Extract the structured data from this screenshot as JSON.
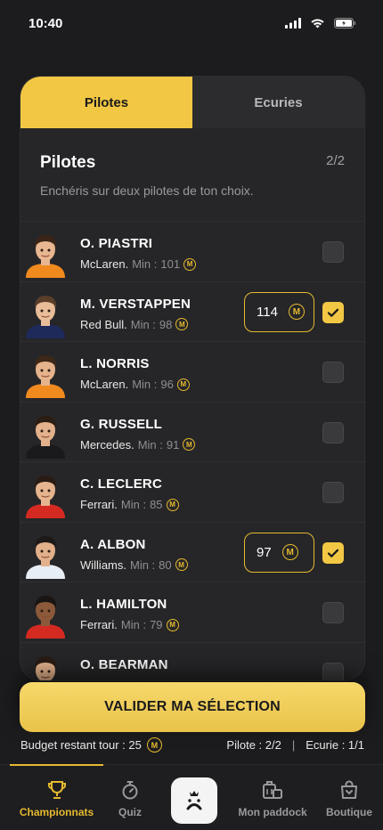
{
  "status": {
    "time": "10:40"
  },
  "tabs": [
    {
      "label": "Pilotes",
      "active": true
    },
    {
      "label": "Ecuries",
      "active": false
    }
  ],
  "section": {
    "title": "Pilotes",
    "count": "2/2",
    "subtitle": "Enchéris sur deux pilotes de ton choix."
  },
  "min_label": "Min :",
  "coin_symbol": "M",
  "drivers": [
    {
      "name": "O. PIASTRI",
      "team": "McLaren.",
      "min": "101",
      "checked": false,
      "bid": "",
      "suit": "#f08a1f",
      "hair": "#3a2417",
      "skin": "#e8b690"
    },
    {
      "name": "M. VERSTAPPEN",
      "team": "Red Bull.",
      "min": "98",
      "checked": true,
      "bid": "114",
      "suit": "#1d2a5a",
      "hair": "#5a3e2a",
      "skin": "#e9bd9a"
    },
    {
      "name": "L. NORRIS",
      "team": "McLaren.",
      "min": "96",
      "checked": false,
      "bid": "",
      "suit": "#f08a1f",
      "hair": "#3d2718",
      "skin": "#e6b38c"
    },
    {
      "name": "G. RUSSELL",
      "team": "Mercedes.",
      "min": "91",
      "checked": false,
      "bid": "",
      "suit": "#1a1a1c",
      "hair": "#2b1d14",
      "skin": "#e3b18c"
    },
    {
      "name": "C. LECLERC",
      "team": "Ferrari.",
      "min": "85",
      "checked": false,
      "bid": "",
      "suit": "#d42a22",
      "hair": "#2a1c14",
      "skin": "#e6b48e"
    },
    {
      "name": "A. ALBON",
      "team": "Williams.",
      "min": "80",
      "checked": true,
      "bid": "97",
      "suit": "#e8eef6",
      "hair": "#1e1a1a",
      "skin": "#e2b08a"
    },
    {
      "name": "L. HAMILTON",
      "team": "Ferrari.",
      "min": "79",
      "checked": false,
      "bid": "",
      "suit": "#d42a22",
      "hair": "#1a1512",
      "skin": "#8c5a3a"
    },
    {
      "name": "O. BEARMAN",
      "team": "",
      "min": "",
      "checked": false,
      "bid": "",
      "suit": "#f2f2f2",
      "hair": "#2a1c14",
      "skin": "#e6b48e"
    }
  ],
  "cta": {
    "label": "VALIDER MA SÉLECTION"
  },
  "footer": {
    "budget": "Budget restant tour : 25",
    "pilote": "Pilote : 2/2",
    "ecurie": "Ecurie : 1/1"
  },
  "nav": [
    {
      "label": "Championnats",
      "icon": "trophy-icon",
      "active": true
    },
    {
      "label": "Quiz",
      "icon": "stopwatch-icon",
      "active": false
    },
    {
      "label": "Mon paddock",
      "icon": "paddock-icon",
      "active": false
    },
    {
      "label": "Boutique",
      "icon": "shop-bag-icon",
      "active": false
    }
  ],
  "colors": {
    "accent": "#f2c744",
    "background": "#1c1c1e",
    "card": "#262628"
  }
}
